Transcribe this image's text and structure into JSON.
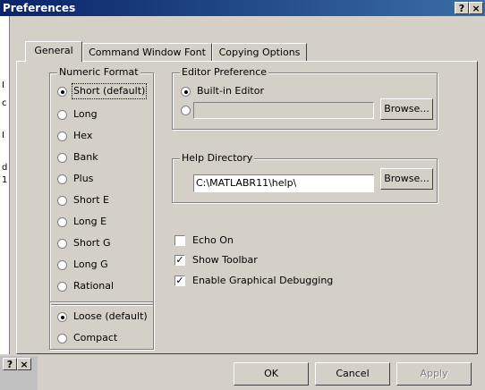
{
  "window": {
    "title": "Preferences",
    "help_btn": "?",
    "close_btn": "×"
  },
  "background_window": {
    "glyphs": [
      "I",
      "c",
      "Ⅰ",
      "d",
      "1"
    ],
    "help_btn": "?",
    "close_btn": "×"
  },
  "tabs": [
    {
      "label": "General",
      "active": true
    },
    {
      "label": "Command Window Font",
      "active": false
    },
    {
      "label": "Copying Options",
      "active": false
    }
  ],
  "numeric_format": {
    "title": "Numeric Format",
    "options": [
      "Short (default)",
      "Long",
      "Hex",
      "Bank",
      "Plus",
      "Short E",
      "Long E",
      "Short G",
      "Long G",
      "Rational"
    ],
    "selected": "Short (default)"
  },
  "spacing": {
    "options": [
      "Loose (default)",
      "Compact"
    ],
    "selected": "Loose (default)"
  },
  "editor_preference": {
    "title": "Editor Preference",
    "builtin_label": "Built-in Editor",
    "custom_value": "",
    "browse_label": "Browse..."
  },
  "help_directory": {
    "title": "Help Directory",
    "path": "C:\\MATLABR11\\help\\",
    "browse_label": "Browse..."
  },
  "checkboxes": [
    {
      "label": "Echo On",
      "checked": false
    },
    {
      "label": "Show Toolbar",
      "checked": true
    },
    {
      "label": "Enable Graphical Debugging",
      "checked": true
    }
  ],
  "buttons": {
    "ok": "OK",
    "cancel": "Cancel",
    "apply": "Apply"
  }
}
